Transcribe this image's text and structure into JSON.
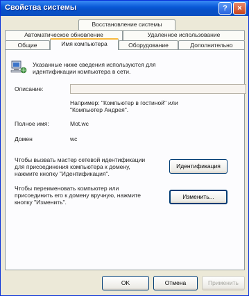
{
  "window": {
    "title": "Свойства системы"
  },
  "title_buttons": {
    "help": "?",
    "close": "×"
  },
  "tabs": {
    "row1": [
      {
        "label": "Восстановление системы"
      }
    ],
    "row2": [
      {
        "label": "Автоматическое обновление"
      },
      {
        "label": "Удаленное использование"
      }
    ],
    "row3": [
      {
        "label": "Общие"
      },
      {
        "label": "Имя компьютера"
      },
      {
        "label": "Оборудование"
      },
      {
        "label": "Дополнительно"
      }
    ],
    "active": "Имя компьютера"
  },
  "panel": {
    "intro_line1": "Указанные ниже сведения используются для",
    "intro_line2": "идентификации компьютера в сети.",
    "description_label": "Описание:",
    "description_value": "",
    "example_line1": "Например: \"Компьютер в гостиной\" или",
    "example_line2": "\"Компьютер Андрея\".",
    "full_name_label": "Полное имя:",
    "full_name_value": "Mot.wc",
    "domain_label": "Домен",
    "domain_value": "wc",
    "wizard_line1": "Чтобы вызвать мастер сетевой идентификации",
    "wizard_line2": "для присоединения компьютера к домену,",
    "wizard_line3": "нажмите кнопку \"Идентификация\".",
    "identify_button": "Идентификация",
    "rename_line1": "Чтобы переименовать компьютер или",
    "rename_line2": "присоединить его к домену вручную, нажмите",
    "rename_line3": "кнопку \"Изменить\".",
    "change_button": "Изменить..."
  },
  "footer": {
    "ok": "OK",
    "cancel": "Отмена",
    "apply": "Применить"
  }
}
